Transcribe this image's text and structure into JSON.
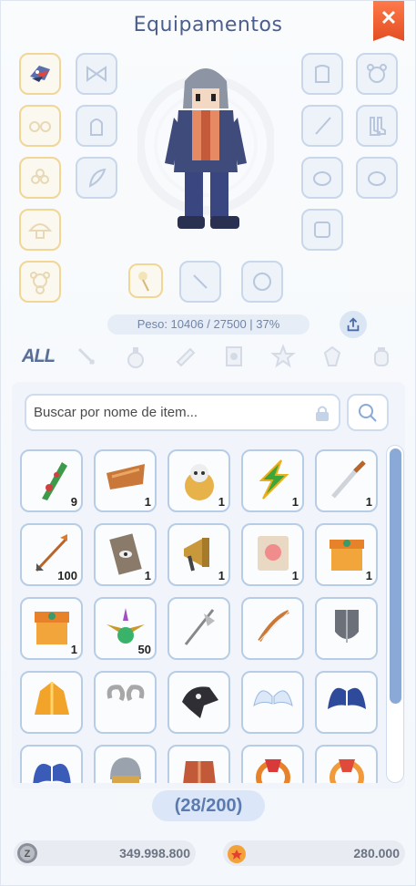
{
  "window": {
    "title": "Equipamentos",
    "close_label": "✕"
  },
  "weight": {
    "text": "Peso: 10406 / 27500  |  37%"
  },
  "filters": {
    "all_label": "ALL"
  },
  "search": {
    "placeholder": "Buscar por nome de item..."
  },
  "inventory": {
    "count_label": "(28/200)",
    "items": [
      {
        "icon": "green-plant-icon",
        "qty": "9"
      },
      {
        "icon": "fur-pelt-icon",
        "qty": "1"
      },
      {
        "icon": "skull-shield-icon",
        "qty": "1"
      },
      {
        "icon": "lightning-bolt-icon",
        "qty": "1"
      },
      {
        "icon": "dagger-icon",
        "qty": "1"
      },
      {
        "icon": "arrow-icon",
        "qty": "100"
      },
      {
        "icon": "eye-tablet-icon",
        "qty": "1"
      },
      {
        "icon": "megaphone-icon",
        "qty": "1"
      },
      {
        "icon": "scroll-card-icon",
        "qty": "1"
      },
      {
        "icon": "gift-box-icon",
        "qty": "1"
      },
      {
        "icon": "gift-box-open-icon",
        "qty": "1"
      },
      {
        "icon": "winged-potion-icon",
        "qty": "50"
      },
      {
        "icon": "halberd-icon",
        "qty": ""
      },
      {
        "icon": "bow-icon",
        "qty": ""
      },
      {
        "icon": "shield-icon",
        "qty": ""
      },
      {
        "icon": "golden-robe-icon",
        "qty": ""
      },
      {
        "icon": "ram-horns-icon",
        "qty": ""
      },
      {
        "icon": "crow-mask-icon",
        "qty": ""
      },
      {
        "icon": "angel-wings-icon",
        "qty": ""
      },
      {
        "icon": "blue-wings-icon",
        "qty": ""
      },
      {
        "icon": "blue-wings-2-icon",
        "qty": ""
      },
      {
        "icon": "helm-icon",
        "qty": ""
      },
      {
        "icon": "red-armor-icon",
        "qty": ""
      },
      {
        "icon": "badge-ring-icon",
        "qty": ""
      },
      {
        "icon": "badge-ring-2-icon",
        "qty": ""
      }
    ]
  },
  "currency": {
    "zeny": "349.998.800",
    "cash": "280.000"
  },
  "colors": {
    "accent": "#4b5e8c",
    "slot_border": "#c9d7ea",
    "gold_border": "#f1d696",
    "close": "#e24e22"
  }
}
